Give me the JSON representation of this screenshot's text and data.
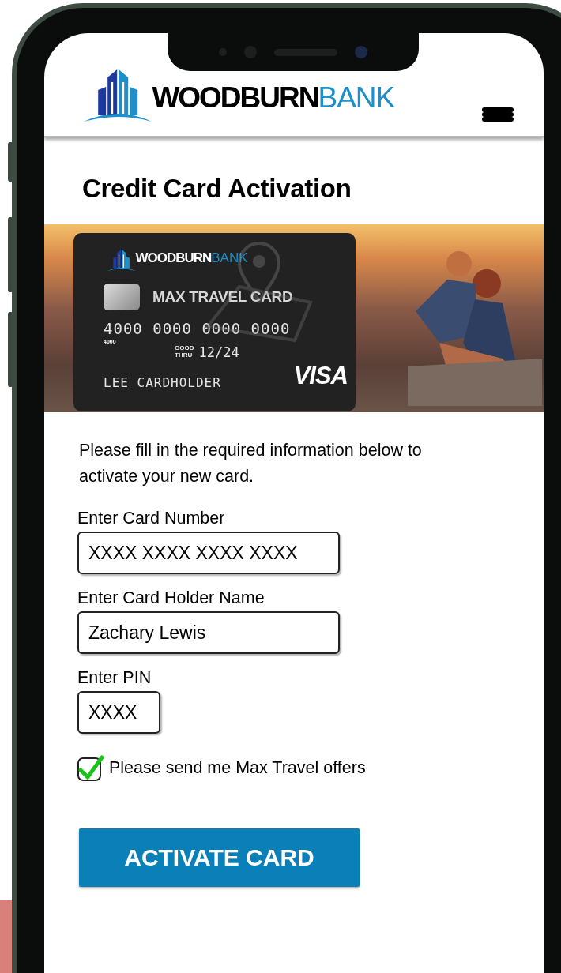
{
  "header": {
    "logo": {
      "name": "WOODBURN",
      "suffix": "BANK"
    }
  },
  "title": "Credit Card Activation",
  "card": {
    "logo": {
      "name": "WOODBURN",
      "suffix": "BANK"
    },
    "product": "MAX TRAVEL CARD",
    "number": "4000 0000 0000 0000",
    "number_small": "4000",
    "good_thru": [
      "GOOD",
      "THRU"
    ],
    "expiry": "12/24",
    "holder": "LEE CARDHOLDER",
    "network": "VISA"
  },
  "intro": "Please fill in the required information below to activate your new card.",
  "fields": [
    {
      "kind": "wide",
      "label": "Enter Card Number",
      "placeholder": "XXXX XXXX XXXX XXXX"
    },
    {
      "kind": "wide",
      "label": "Enter Card Holder Name",
      "value": "Zachary Lewis"
    },
    {
      "kind": "short",
      "label": "Enter PIN",
      "placeholder": "XXXX"
    }
  ],
  "checkbox": {
    "label": "Please send me Max Travel offers",
    "checked": true
  },
  "button": "ACTIVATE CARD"
}
